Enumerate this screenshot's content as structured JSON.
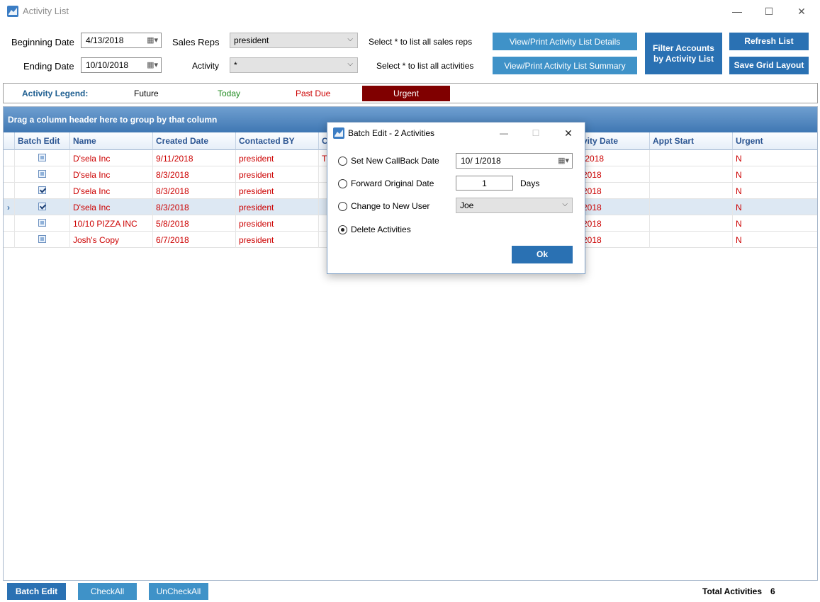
{
  "window": {
    "title": "Activity List",
    "minimize": "—",
    "maximize": "☐",
    "close": "✕"
  },
  "filters": {
    "beginning_label": "Beginning Date",
    "beginning_value": "4/13/2018",
    "ending_label": "Ending Date",
    "ending_value": "10/10/2018",
    "sales_reps_label": "Sales Reps",
    "sales_reps_value": "president",
    "activity_label": "Activity",
    "activity_value": "*",
    "sales_reps_hint": "Select * to list all sales reps",
    "activity_hint": "Select * to list all activities"
  },
  "buttons": {
    "view_details": "View/Print Activity List Details",
    "view_summary": "View/Print Activity List Summary",
    "filter_accounts_line1": "Filter Accounts",
    "filter_accounts_line2": "by Activity List",
    "refresh": "Refresh List",
    "save_grid": "Save Grid Layout"
  },
  "legend": {
    "title": "Activity Legend:",
    "future": "Future",
    "today": "Today",
    "past_due": "Past Due",
    "urgent": "Urgent",
    "colors": {
      "title": "#1f5f91",
      "future": "#000000",
      "today": "#1e8a1e",
      "past_due": "#cc0000",
      "urgent_bg": "#800000"
    }
  },
  "grid": {
    "group_hint": "Drag a column header here to group by that column",
    "columns": [
      "Batch Edit",
      "Name",
      "Created Date",
      "Contacted BY",
      "C",
      "vity Date",
      "Appt Start",
      "Urgent"
    ],
    "rows": [
      {
        "checked": false,
        "name": "D'sela Inc",
        "created": "9/11/2018",
        "contacted": "president",
        "c": "T",
        "activity_date": "/2018",
        "appt": "",
        "urgent": "N",
        "selected": false
      },
      {
        "checked": false,
        "name": "D'sela Inc",
        "created": "8/3/2018",
        "contacted": "president",
        "c": "",
        "activity_date": "2018",
        "appt": "",
        "urgent": "N",
        "selected": false
      },
      {
        "checked": true,
        "name": "D'sela Inc",
        "created": "8/3/2018",
        "contacted": "president",
        "c": "",
        "activity_date": "2018",
        "appt": "",
        "urgent": "N",
        "selected": false
      },
      {
        "checked": true,
        "name": "D'sela Inc",
        "created": "8/3/2018",
        "contacted": "president",
        "c": "",
        "activity_date": "2018",
        "appt": "",
        "urgent": "N",
        "selected": true
      },
      {
        "checked": false,
        "name": "10/10 PIZZA INC",
        "created": "5/8/2018",
        "contacted": "president",
        "c": "",
        "activity_date": "2018",
        "appt": "",
        "urgent": "N",
        "selected": false
      },
      {
        "checked": false,
        "name": "Josh's Copy",
        "created": "6/7/2018",
        "contacted": "president",
        "c": "",
        "activity_date": "2018",
        "appt": "",
        "urgent": "N",
        "selected": false
      }
    ],
    "row_indicator": "›"
  },
  "bottom": {
    "batch_edit": "Batch Edit",
    "check_all": "CheckAll",
    "uncheck_all": "UnCheckAll",
    "total_label": "Total Activities",
    "total_value": "6"
  },
  "dialog": {
    "title": "Batch Edit - 2 Activities",
    "minimize": "—",
    "maximize": "☐",
    "close": "✕",
    "opt_callback": "Set New CallBack Date",
    "callback_value": "10/  1/2018",
    "opt_forward": "Forward Original Date",
    "forward_value": "1",
    "days_label": "Days",
    "opt_user": "Change to New User",
    "user_value": "Joe",
    "opt_delete": "Delete Activities",
    "selected_option": "delete",
    "ok": "Ok"
  },
  "colors": {
    "accent_teal": "#3f92c8",
    "accent_blue": "#2a71b3",
    "row_text": "#cc0000"
  }
}
